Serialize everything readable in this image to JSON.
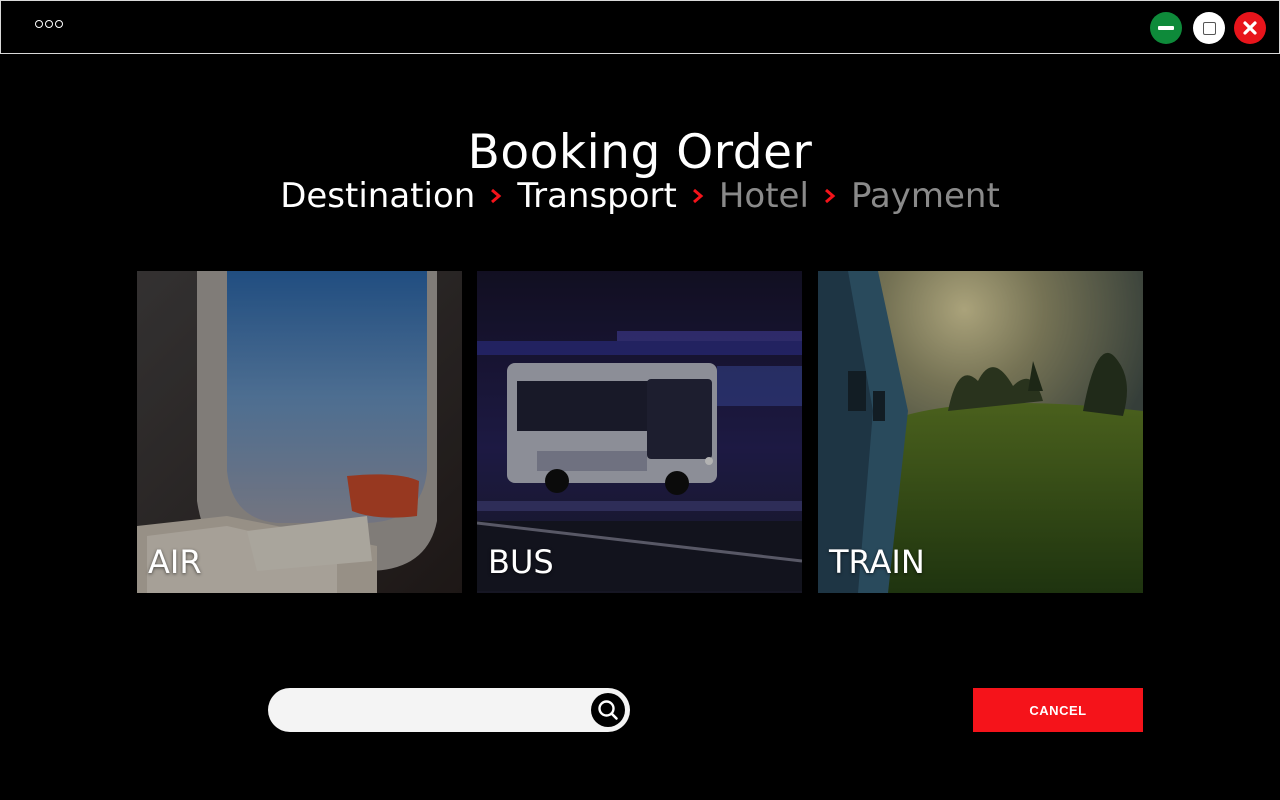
{
  "window": {
    "menu_icon": "more-dots-icon",
    "controls": [
      {
        "icon": "minimize-icon",
        "color": "#0e8a3a"
      },
      {
        "icon": "maximize-icon",
        "color": "#ffffff"
      },
      {
        "icon": "close-icon",
        "color": "#e8141b"
      }
    ]
  },
  "page": {
    "title": "Booking Order"
  },
  "steps": [
    {
      "label": "Destination",
      "state": "done"
    },
    {
      "label": "Transport",
      "state": "current"
    },
    {
      "label": "Hotel",
      "state": "pending"
    },
    {
      "label": "Payment",
      "state": "pending"
    }
  ],
  "step_separator_icon": "chevron-right-icon",
  "transport_options": [
    {
      "label": "AIR",
      "image": "airplane-window-photo"
    },
    {
      "label": "BUS",
      "image": "city-bus-night-photo"
    },
    {
      "label": "TRAIN",
      "image": "train-countryside-photo"
    }
  ],
  "search": {
    "placeholder": "",
    "value": "",
    "icon": "search-icon"
  },
  "actions": {
    "cancel_label": "CANCEL"
  },
  "colors": {
    "accent": "#f5131a",
    "background": "#000000",
    "inactive_step": "#8a8a8a",
    "search_bg": "#f4f4f4"
  }
}
